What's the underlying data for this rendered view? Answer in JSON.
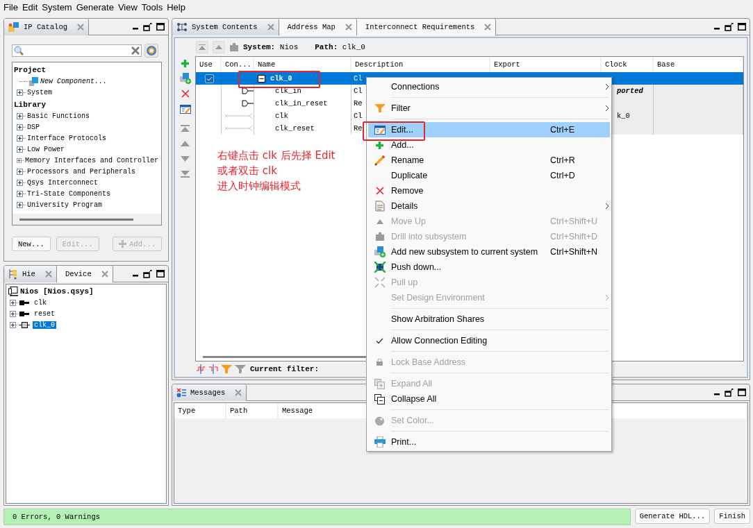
{
  "menu_bar": [
    "File",
    "Edit",
    "System",
    "Generate",
    "View",
    "Tools",
    "Help"
  ],
  "ip_catalog": {
    "tabs": [
      {
        "label": "IP Catalog",
        "selected": true
      }
    ],
    "tree": [
      {
        "label": "Project",
        "children": [
          {
            "label": "New Component...",
            "kind": "component"
          },
          {
            "label": "System",
            "kind": "folder"
          }
        ]
      },
      {
        "label": "Library",
        "children": [
          {
            "label": "Basic Functions",
            "kind": "folder"
          },
          {
            "label": "DSP",
            "kind": "folder"
          },
          {
            "label": "Interface Protocols",
            "kind": "folder"
          },
          {
            "label": "Low Power",
            "kind": "folder"
          },
          {
            "label": "Memory Interfaces and Controller",
            "kind": "folder"
          },
          {
            "label": "Processors and Peripherals",
            "kind": "folder"
          },
          {
            "label": "Qsys Interconnect",
            "kind": "folder"
          },
          {
            "label": "Tri-State Components",
            "kind": "folder"
          },
          {
            "label": "University Program",
            "kind": "folder"
          }
        ]
      }
    ],
    "buttons": [
      {
        "label": "New...",
        "kind": "plain",
        "disabled": false
      },
      {
        "label": "Edit...",
        "kind": "plain",
        "disabled": true
      },
      {
        "label": "Add...",
        "kind": "add",
        "disabled": true
      }
    ]
  },
  "hierarchy": {
    "tabs": [
      {
        "label": "Hie",
        "selected": true
      },
      {
        "label": "Device",
        "selected": false
      }
    ],
    "root": "Nios [Nios.qsys]",
    "children": [
      {
        "label": "clk",
        "kind": "port",
        "selected": false
      },
      {
        "label": "reset",
        "kind": "port",
        "selected": false
      },
      {
        "label": "clk_0",
        "kind": "module",
        "selected": true
      }
    ]
  },
  "system_contents": {
    "tabs": [
      {
        "label": "System Contents",
        "selected": true
      },
      {
        "label": "Address Map",
        "selected": false
      },
      {
        "label": "Interconnect Requirements",
        "selected": false
      }
    ],
    "breadcrumb": {
      "system_label": "System:",
      "system": "Nios",
      "path_label": "Path:",
      "path": "clk_0"
    },
    "columns": [
      "Use",
      "Con...",
      "Name",
      "Description",
      "Export",
      "Clock",
      "Base"
    ],
    "rows": [
      {
        "kind": "module",
        "use": true,
        "expanded": true,
        "selected": true,
        "name": "clk_0",
        "description": "Cl"
      },
      {
        "kind": "input",
        "selected": false,
        "name": "clk_in",
        "description": "Cl",
        "clock": "ported"
      },
      {
        "kind": "input",
        "selected": false,
        "name": "clk_in_reset",
        "description": "Re"
      },
      {
        "kind": "output",
        "selected": false,
        "name": "clk",
        "description": "Cl",
        "clock": "k_0"
      },
      {
        "kind": "output",
        "selected": false,
        "name": "clk_reset",
        "description": "Re"
      }
    ],
    "filter_label": "Current filter:"
  },
  "messages": {
    "tabs": [
      {
        "label": "Messages",
        "selected": true
      }
    ],
    "columns": [
      "Type",
      "Path",
      "Message"
    ]
  },
  "status": {
    "text": "0 Errors, 0 Warnings",
    "buttons": [
      "Generate HDL...",
      "Finish"
    ]
  },
  "annotation": {
    "lines": [
      "右键点击 clk 后先择 Edit",
      "或者双击 clk",
      "进入时钟编辑模式"
    ]
  },
  "context_menu": {
    "groups": [
      [
        {
          "label": "Connections",
          "kind": "none",
          "disabled": false,
          "selected": false,
          "checked": false,
          "submenu": true
        }
      ],
      [
        {
          "label": "Filter",
          "kind": "filter",
          "disabled": false,
          "selected": false,
          "checked": false,
          "submenu": true
        }
      ],
      [
        {
          "label": "Edit...",
          "shortcut": "Ctrl+E",
          "kind": "edit",
          "disabled": false,
          "selected": true,
          "checked": false,
          "submenu": false
        },
        {
          "label": "Add...",
          "kind": "add",
          "disabled": false,
          "selected": false,
          "checked": false,
          "submenu": false
        },
        {
          "label": "Rename",
          "shortcut": "Ctrl+R",
          "kind": "rename",
          "disabled": false,
          "selected": false,
          "checked": false,
          "submenu": false
        },
        {
          "label": "Duplicate",
          "shortcut": "Ctrl+D",
          "kind": "none",
          "disabled": false,
          "selected": false,
          "checked": false,
          "submenu": false
        },
        {
          "label": "Remove",
          "kind": "remove",
          "disabled": false,
          "selected": false,
          "checked": false,
          "submenu": false
        },
        {
          "label": "Details",
          "kind": "details",
          "disabled": false,
          "selected": false,
          "checked": false,
          "submenu": true
        },
        {
          "label": "Move Up",
          "shortcut": "Ctrl+Shift+U",
          "kind": "move-up",
          "disabled": true,
          "selected": false,
          "checked": false,
          "submenu": false
        },
        {
          "label": "Drill into subsystem",
          "shortcut": "Ctrl+Shift+D",
          "kind": "drill",
          "disabled": true,
          "selected": false,
          "checked": false,
          "submenu": false
        },
        {
          "label": "Add new subsystem to current system",
          "shortcut": "Ctrl+Shift+N",
          "kind": "add-subsystem",
          "disabled": false,
          "selected": false,
          "checked": false,
          "submenu": false
        },
        {
          "label": "Push down...",
          "kind": "push-down",
          "disabled": false,
          "selected": false,
          "checked": false,
          "submenu": false
        },
        {
          "label": "Pull up",
          "kind": "pull-up",
          "disabled": true,
          "selected": false,
          "checked": false,
          "submenu": false
        },
        {
          "label": "Set Design Environment",
          "kind": "none",
          "disabled": true,
          "selected": false,
          "checked": false,
          "submenu": true
        }
      ],
      [
        {
          "label": "Show Arbitration Shares",
          "kind": "none",
          "disabled": false,
          "selected": false,
          "checked": false,
          "submenu": false
        }
      ],
      [
        {
          "label": "Allow Connection Editing",
          "kind": "none",
          "disabled": false,
          "selected": false,
          "checked": true,
          "submenu": false
        }
      ],
      [
        {
          "label": "Lock Base Address",
          "kind": "lock",
          "disabled": true,
          "selected": false,
          "checked": false,
          "submenu": false
        }
      ],
      [
        {
          "label": "Expand All",
          "kind": "expand",
          "disabled": true,
          "selected": false,
          "checked": false,
          "submenu": false
        },
        {
          "label": "Collapse All",
          "kind": "collapse",
          "disabled": false,
          "selected": false,
          "checked": false,
          "submenu": false
        }
      ],
      [
        {
          "label": "Set Color...",
          "kind": "color",
          "disabled": true,
          "selected": false,
          "checked": false,
          "submenu": false
        }
      ],
      [
        {
          "label": "Print...",
          "kind": "print",
          "disabled": false,
          "selected": false,
          "checked": false,
          "submenu": false
        }
      ]
    ]
  }
}
